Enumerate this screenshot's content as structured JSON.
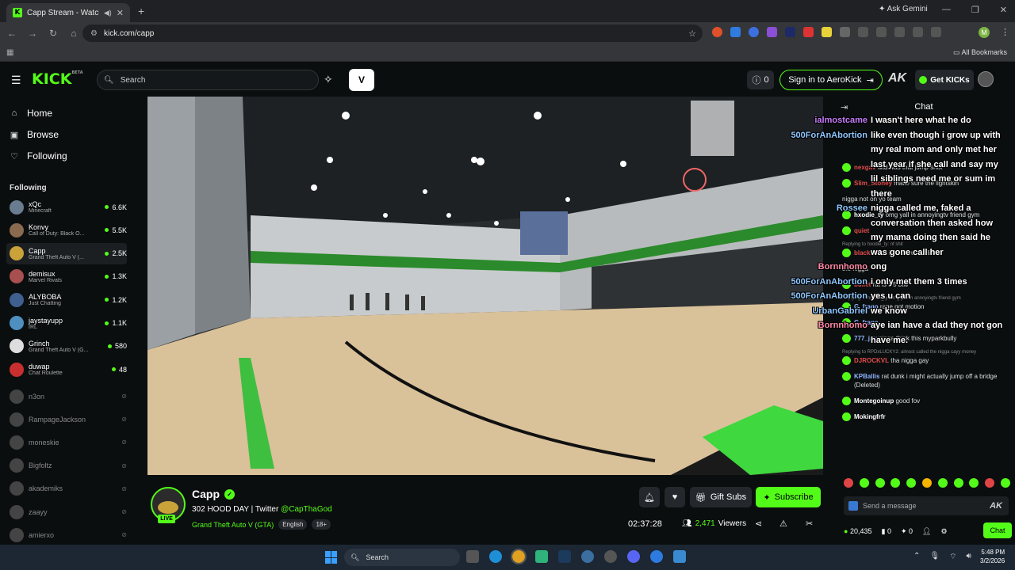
{
  "browser": {
    "tab_title": "Capp Stream - Watch Live ...",
    "tab_favicon": "K",
    "url": "kick.com/capp",
    "gemini": "Ask Gemini",
    "all_bookmarks": "All Bookmarks",
    "profile_initial": "M"
  },
  "header": {
    "logo": "KICK",
    "logo_beta": "BETA",
    "search_placeholder": "Search",
    "v_button": "V",
    "counter": "0",
    "signin": "Sign in to AeroKick",
    "ak": "AK",
    "get_kicks": "Get KICKs"
  },
  "sidebar": {
    "nav": [
      {
        "label": "Home",
        "icon": "home-icon"
      },
      {
        "label": "Browse",
        "icon": "browse-icon"
      },
      {
        "label": "Following",
        "icon": "heart-icon"
      }
    ],
    "following_header": "Following",
    "following": [
      {
        "name": "xQc",
        "game": "Minecraft",
        "viewers": "6.6K",
        "color": "#6a7c8f"
      },
      {
        "name": "Konvy",
        "game": "Call of Duty: Black O...",
        "viewers": "5.5K",
        "color": "#8a6a4f"
      },
      {
        "name": "Capp",
        "game": "Grand Theft Auto V (...",
        "viewers": "2.5K",
        "color": "#c9a23a"
      },
      {
        "name": "demisux",
        "game": "Marvel Rivals",
        "viewers": "1.3K",
        "color": "#a84f4f"
      },
      {
        "name": "ALYBOBA",
        "game": "Just Chatting",
        "viewers": "1.2K",
        "color": "#3f5f8f"
      },
      {
        "name": "jaystayupp",
        "game": "IRL",
        "viewers": "1.1K",
        "color": "#4f8fbf"
      },
      {
        "name": "Grinch",
        "game": "Grand Theft Auto V (G...",
        "viewers": "580",
        "color": "#dddddd"
      },
      {
        "name": "duwap",
        "game": "Chat Roulette",
        "viewers": "48",
        "color": "#c83030"
      }
    ],
    "offline": [
      "n3on",
      "RampageJackson",
      "moneskie",
      "Bigfoltz",
      "akademiks",
      "zaayy",
      "amierxo"
    ]
  },
  "stream": {
    "channel": "Capp",
    "live_badge": "LIVE",
    "title_prefix": "302 HOOD DAY | Twitter",
    "twitter": "@CapThaGod",
    "category": "Grand Theft Auto V (GTA)",
    "language": "English",
    "rating": "18+",
    "gift_subs": "Gift Subs",
    "subscribe": "Subscribe",
    "uptime": "02:37:28",
    "viewers_count": "2,471",
    "viewers_label": "Viewers"
  },
  "chat": {
    "title": "Chat",
    "messages": [
      {
        "user": "nexgav",
        "color": "#e34b4b",
        "text": "wtd was that jump shot",
        "reply": ""
      },
      {
        "user": "Slim_Stoney",
        "color": "#e34b4b",
        "text": "make sure the lightskin",
        "reply": ""
      },
      {
        "user": "",
        "color": "#aaaaaa",
        "text": "nigga not on yo team",
        "reply": ""
      },
      {
        "user": "hxodie_ty",
        "color": "#ffffff",
        "text": "omg yall in annoyingtv friend gym",
        "reply": ""
      },
      {
        "user": "quiet",
        "color": "#e34b4b",
        "text": "",
        "reply": ""
      },
      {
        "user": "",
        "color": "#aaaaaa",
        "text": "",
        "reply": "Replying to hxodie_ty: nf shit"
      },
      {
        "user": "blackwood",
        "color": "#e34b4b",
        "text": "if he do unrealistic",
        "reply": ""
      },
      {
        "user": "",
        "color": "#ffffff",
        "text": "the nigga",
        "reply": ""
      },
      {
        "user": "bullet",
        "color": "#e34b4b",
        "text": "rat is 5'5 btw",
        "reply": ""
      },
      {
        "user": "",
        "color": "#aaaaaa",
        "text": "",
        "reply": "Replying to hxodie_ty: omg yall in annoyingtv friend gym"
      },
      {
        "user": "G_frago",
        "color": "#8fb4ff",
        "text": "rage got motion",
        "reply": ""
      },
      {
        "user": "G_frago",
        "color": "#8fb4ff",
        "text": "",
        "reply": ""
      },
      {
        "user": "777_jay",
        "color": "#8fb4ff",
        "text": "nigga think this myparkbully",
        "reply": ""
      },
      {
        "user": "",
        "color": "#aaaaaa",
        "text": "",
        "reply": "Replying to RPDxLUCKY2: almost called the nigga cayy money"
      },
      {
        "user": "DJROCKVL",
        "color": "#e34b4b",
        "text": "tha nigga gay",
        "reply": ""
      },
      {
        "user": "KPBallis",
        "color": "#8fb4ff",
        "text": "rat dunk i might actually jump off a bridge (Deleted)",
        "reply": ""
      },
      {
        "user": "Montegoinup",
        "color": "#ffffff",
        "text": "good fov",
        "reply": ""
      },
      {
        "user": "Mokingfrfr",
        "color": "#ffffff",
        "text": "",
        "reply": ""
      }
    ],
    "overlay": [
      {
        "user": "ialmostcame",
        "color": "#c77dff",
        "text": "I wasn't here what he do"
      },
      {
        "user": "500ForAnAbortion",
        "color": "#8fc8ff",
        "text": "like even though i grow up with"
      },
      {
        "user": "",
        "color": "#ffffff",
        "text": "my real mom and only met her"
      },
      {
        "user": "",
        "color": "#ffffff",
        "text": "last year if she call and say my"
      },
      {
        "user": "",
        "color": "#ffffff",
        "text": "lil siblings need me or sum im"
      },
      {
        "user": "",
        "color": "#ffffff",
        "text": "there"
      },
      {
        "user": "Rossee",
        "color": "#8fc8ff",
        "text": "nigga called me, faked a"
      },
      {
        "user": "",
        "color": "#ffffff",
        "text": "conversation then asked how"
      },
      {
        "user": "",
        "color": "#ffffff",
        "text": "my mama doing then said he"
      },
      {
        "user": "",
        "color": "#ffffff",
        "text": "was gone call her"
      },
      {
        "user": "Bornnhomo",
        "color": "#ff8aa8",
        "text": "ong"
      },
      {
        "user": "500ForAnAbortion",
        "color": "#8fc8ff",
        "text": "i only met them 3 times"
      },
      {
        "user": "500ForAnAbortion",
        "color": "#8fc8ff",
        "text": "yes u can"
      },
      {
        "user": "UrbanGabriel",
        "color": "#8fc8ff",
        "text": "we know"
      },
      {
        "user": "Bornnhomo",
        "color": "#ff8aa8",
        "text": "aye ian have a dad they not gon"
      },
      {
        "user": "",
        "color": "#ffffff",
        "text": "have me."
      }
    ],
    "input_placeholder": "Send a message",
    "input_ak": "AK",
    "kicks": "20,435",
    "count_a": "0",
    "count_b": "0",
    "chat_button": "Chat"
  },
  "taskbar": {
    "search": "Search",
    "time": "5:48 PM",
    "date": "3/2/2026"
  }
}
